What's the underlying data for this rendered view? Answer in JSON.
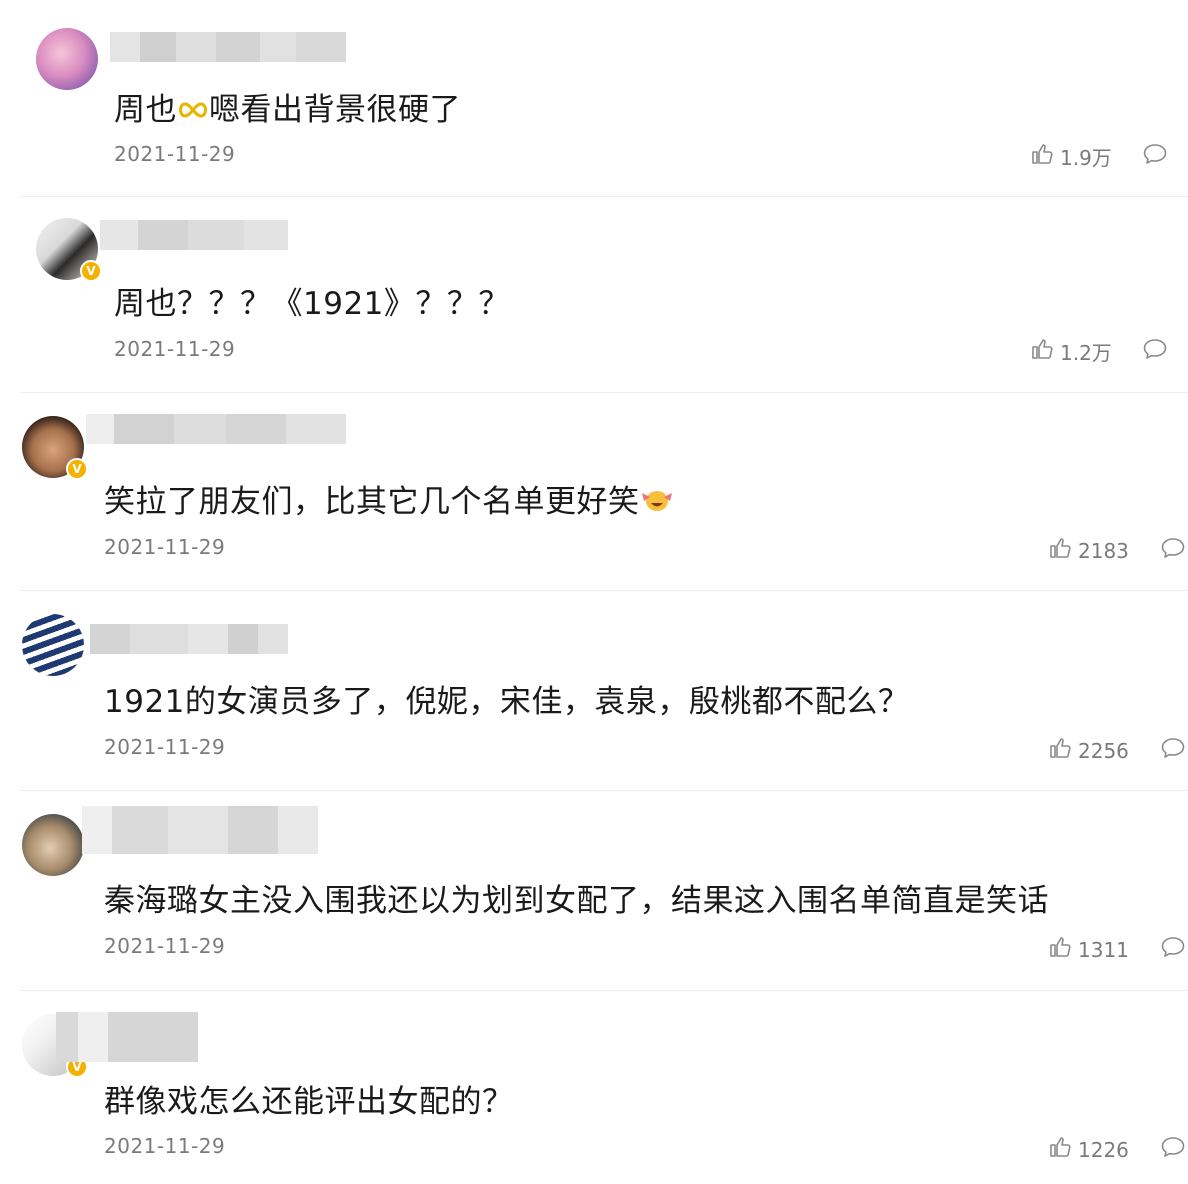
{
  "comments": [
    {
      "text_before": "周也",
      "emoji": "infinity-emoji",
      "text_after": "嗯看出背景很硬了",
      "date": "2021-11-29",
      "likes": "1.9万",
      "verified": false
    },
    {
      "text": "周也？？？《1921》？？？",
      "date": "2021-11-29",
      "likes": "1.2万",
      "verified": true
    },
    {
      "text": "笑拉了朋友们，比其它几个名单更好笑",
      "emoji": "laugh-cry-emoji",
      "date": "2021-11-29",
      "likes": "2183",
      "verified": true
    },
    {
      "text": "1921的女演员多了，倪妮，宋佳，袁泉，殷桃都不配么？",
      "date": "2021-11-29",
      "likes": "2256",
      "verified": false
    },
    {
      "text": "秦海璐女主没入围我还以为划到女配了，结果这入围名单简直是笑话",
      "date": "2021-11-29",
      "likes": "1311",
      "verified": false
    },
    {
      "text": "群像戏怎么还能评出女配的？",
      "date": "2021-11-29",
      "likes": "1226",
      "verified": true
    }
  ],
  "icons": {
    "like": "thumbs-up-icon",
    "reply": "comment-bubble-icon",
    "verified": "verified-badge-icon"
  },
  "colors": {
    "text": "#1a1a1a",
    "meta": "#7a7a7a",
    "verified": "#f5b100",
    "divider": "#ececec"
  }
}
